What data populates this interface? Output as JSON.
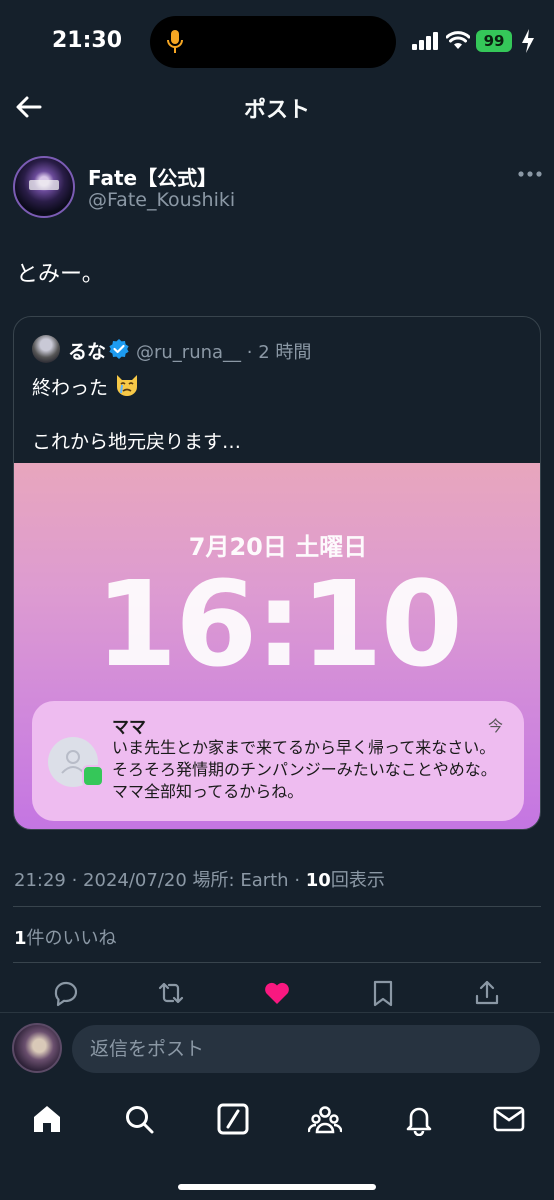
{
  "status_bar": {
    "time": "21:30",
    "battery": "99",
    "icons": [
      "microphone-icon",
      "signal-icon",
      "wifi-icon",
      "battery-icon",
      "charging-bolt-icon"
    ]
  },
  "header": {
    "title": "ポスト",
    "back_icon": "back-arrow-icon"
  },
  "post": {
    "author_name": "Fate【公式】",
    "author_handle": "@Fate_Koushiki",
    "text": "とみー。",
    "more_icon": "more-horizontal-icon",
    "time": "21:29",
    "date": "2024/07/20",
    "location": "場所: Earth",
    "views_count": "10",
    "views_label": "回表示",
    "likes_count": "1",
    "likes_label": "件のいいね"
  },
  "quote": {
    "name": "るな",
    "handle": "@ru_runa__",
    "age": "· 2 時間",
    "line1": "終わった",
    "line2": "これから地元戻ります…",
    "verified_icon": "verified-badge-icon",
    "emoji_icon": "crying-cat-emoji-icon"
  },
  "screenshot": {
    "date": "7月20日 土曜日",
    "time": "16:10",
    "notification": {
      "sender": "ママ",
      "when": "今",
      "body": "いま先生とか家まで来てるから早く帰って来なさい。 そろそろ発情期のチンパンジーみたいなことやめな。 ママ全部知ってるからね。"
    }
  },
  "actions": {
    "icons": [
      "reply-icon",
      "retweet-icon",
      "like-icon",
      "bookmark-icon",
      "share-icon"
    ],
    "like_color": "#f91880"
  },
  "reply": {
    "placeholder": "返信をポスト"
  },
  "nav": {
    "icons": [
      "home-icon",
      "search-icon",
      "grok-icon",
      "communities-icon",
      "notifications-icon",
      "messages-icon"
    ]
  },
  "colors": {
    "background": "#15202b",
    "secondary_text": "#8b98a5",
    "border": "#38444d",
    "verified": "#1d9bf0"
  }
}
